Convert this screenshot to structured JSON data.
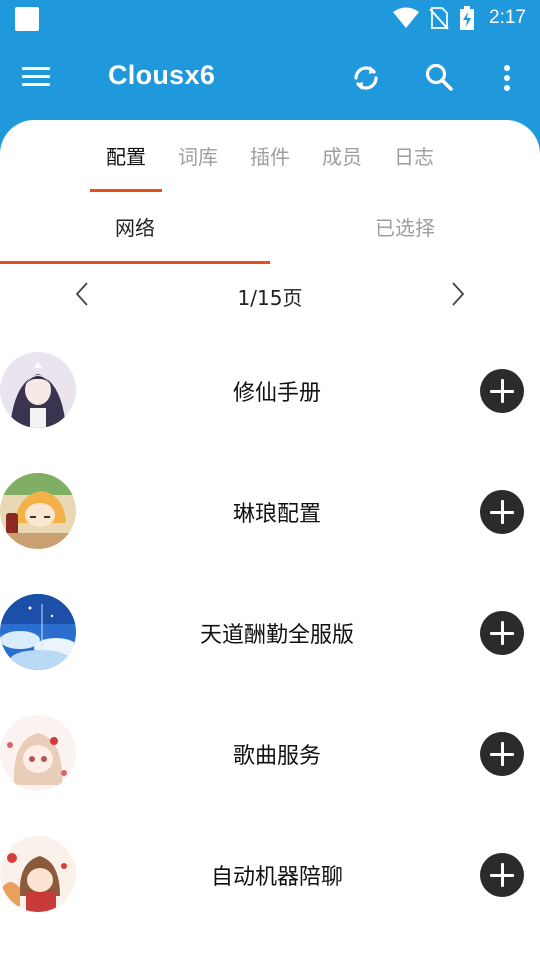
{
  "status_bar": {
    "time": "2:17"
  },
  "app_bar": {
    "title": "Clousx6"
  },
  "top_tabs": [
    {
      "label": "配置",
      "active": true
    },
    {
      "label": "词库",
      "active": false
    },
    {
      "label": "插件",
      "active": false
    },
    {
      "label": "成员",
      "active": false
    },
    {
      "label": "日志",
      "active": false
    }
  ],
  "sub_tabs": [
    {
      "label": "网络",
      "active": true
    },
    {
      "label": "已选择",
      "active": false
    }
  ],
  "pager": {
    "text": "1/15页"
  },
  "items": [
    {
      "title": "修仙手册",
      "avatar_icon": "anime-avatar-icon"
    },
    {
      "title": "琳琅配置",
      "avatar_icon": "anime-avatar-icon"
    },
    {
      "title": "天道酬勤全服版",
      "avatar_icon": "sky-avatar-icon"
    },
    {
      "title": "歌曲服务",
      "avatar_icon": "anime-avatar-icon"
    },
    {
      "title": "自动机器陪聊",
      "avatar_icon": "anime-avatar-icon"
    }
  ],
  "colors": {
    "primary": "#1f98dc",
    "accent": "#e6501a",
    "button": "#2b2b2b"
  }
}
